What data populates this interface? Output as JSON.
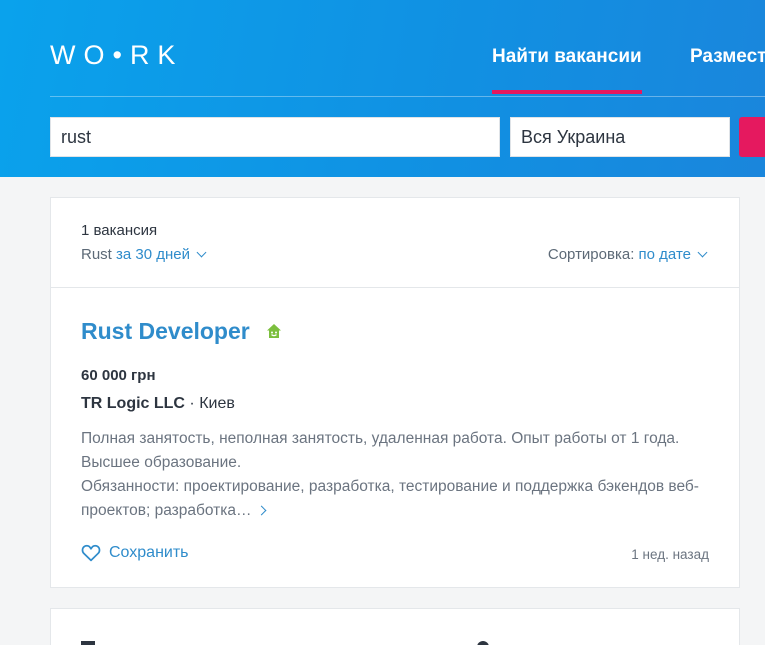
{
  "header": {
    "logo": "WO•RK",
    "nav": {
      "find_jobs": "Найти вакансии",
      "post": "Размест"
    }
  },
  "search": {
    "query": "rust",
    "region": "Вся Украина"
  },
  "results": {
    "count": "1 вакансия",
    "filter_keyword": "Rust",
    "filter_period": "за 30 дней",
    "sort_label": "Сортировка:",
    "sort_value": "по дате"
  },
  "job": {
    "title": "Rust Developer",
    "salary": "60 000 грн",
    "company": "TR Logic LLC",
    "city_separator": " · Киев",
    "description_1": "Полная занятость, неполная занятость, удаленная работа. Опыт работы от 1 года. Высшее образование.",
    "description_2": "Обязанности: проектирование, разработка, тестирование и поддержка бэкендов веб-проектов; разработка…",
    "save_label": "Сохранить",
    "posted": "1 нед. назад",
    "remote_icon": "home-icon",
    "remote_icon_color": "#7cbf3e"
  },
  "colors": {
    "header_blue": "#0aa2ec",
    "accent_pink": "#e5195f",
    "link_blue": "#2f8ccb"
  }
}
